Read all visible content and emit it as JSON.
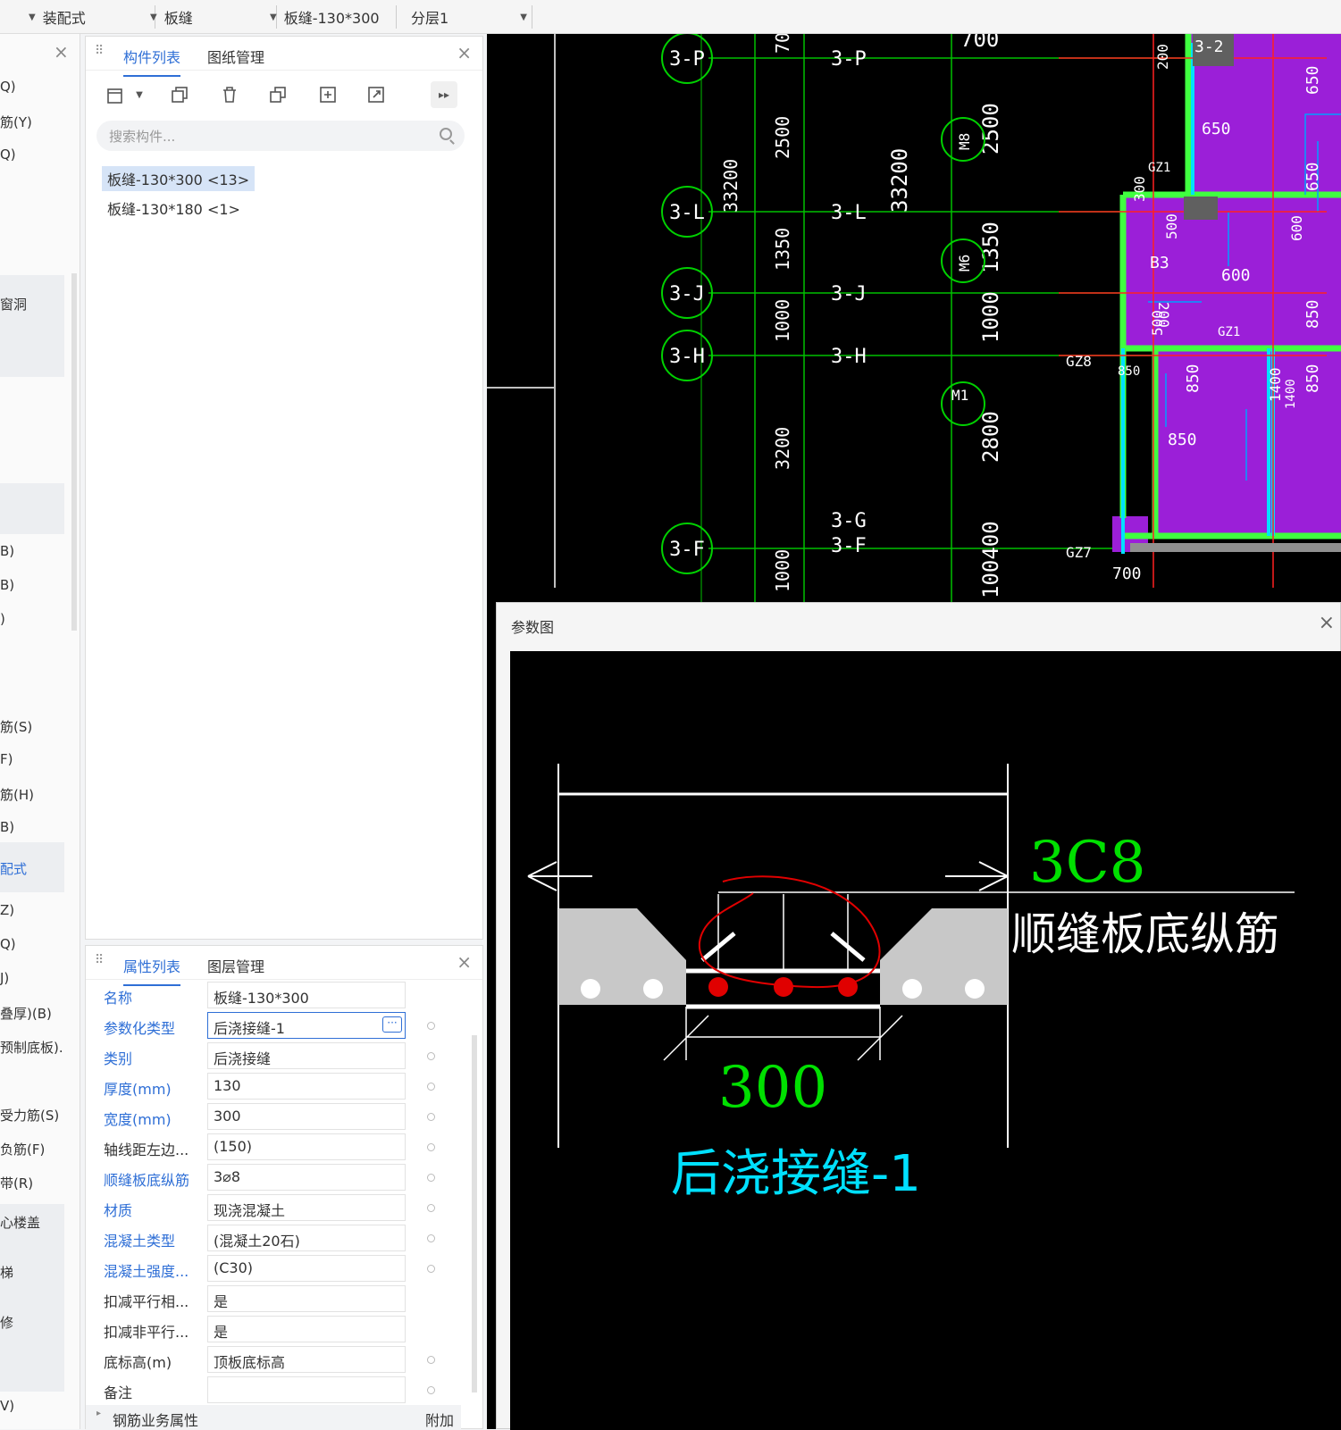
{
  "toolbar": {
    "dd1": "装配式",
    "dd2": "板缝",
    "dd3": "板缝-130*300",
    "dd4": "分层1"
  },
  "left_strip": {
    "items": [
      "Q)",
      "筋(Y)",
      "Q)",
      "窗洞",
      "B)",
      "B)",
      ")",
      "筋(S)",
      "F)",
      "筋(H)",
      "B)",
      "配式",
      "Z)",
      "Q)",
      "J)",
      "叠厚)(B)",
      "预制底板).",
      "受力筋(S)",
      "负筋(F)",
      "带(R)",
      "心楼盖",
      "梯",
      "修",
      "V)"
    ],
    "active": "配式"
  },
  "component_panel": {
    "tabs": [
      "构件列表",
      "图纸管理"
    ],
    "search_placeholder": "搜索构件...",
    "items": [
      "板缝-130*300 <13>",
      "板缝-130*180 <1>"
    ]
  },
  "property_panel": {
    "tabs": [
      "属性列表",
      "图层管理"
    ],
    "rows": [
      {
        "label": "名称",
        "value": "板缝-130*300"
      },
      {
        "label": "参数化类型",
        "value": "后浇接缝-1"
      },
      {
        "label": "类别",
        "value": "后浇接缝"
      },
      {
        "label": "厚度(mm)",
        "value": "130"
      },
      {
        "label": "宽度(mm)",
        "value": "300"
      },
      {
        "label": "轴线距左边...",
        "value": "(150)"
      },
      {
        "label": "顺缝板底纵筋",
        "value": "3⌀8"
      },
      {
        "label": "材质",
        "value": "现浇混凝土"
      },
      {
        "label": "混凝土类型",
        "value": "(混凝土20石)"
      },
      {
        "label": "混凝土强度...",
        "value": "(C30)"
      },
      {
        "label": "扣减平行相...",
        "value": "是"
      },
      {
        "label": "扣减非平行...",
        "value": "是"
      },
      {
        "label": "底标高(m)",
        "value": "顶板底标高"
      },
      {
        "label": "备注",
        "value": ""
      }
    ],
    "footer_label": "钢筋业务属性",
    "footer_extra": "附加"
  },
  "cad": {
    "axis_bubbles": [
      "3-P",
      "3-L",
      "3-J",
      "3-H",
      "3-F"
    ],
    "axis_labels": [
      "3-P",
      "3-L",
      "3-J",
      "3-H",
      "3-G",
      "3-F"
    ],
    "vertical_dims": [
      "700",
      "2500",
      "33200",
      "1350",
      "1000",
      "3200",
      "1000"
    ],
    "door_tags": [
      "M8",
      "M6",
      "M1"
    ],
    "right_dims": [
      "700",
      "2500",
      "33200",
      "1350",
      "1000",
      "2800",
      "100400",
      "200",
      "300",
      "650",
      "650",
      "650",
      "500",
      "200",
      "500",
      "600",
      "600",
      "850",
      "850",
      "850",
      "850",
      "850",
      "1400",
      "1400",
      "700"
    ],
    "room_labels": [
      "3-2",
      "GZ1",
      "B3",
      "GZ1",
      "GZ8",
      "GZ7"
    ]
  },
  "dialog": {
    "title": "参数图",
    "rebar_label": "3C8",
    "rebar_desc": "顺缝板底纵筋",
    "width_label": "300",
    "type_label": "后浇接缝-1"
  }
}
